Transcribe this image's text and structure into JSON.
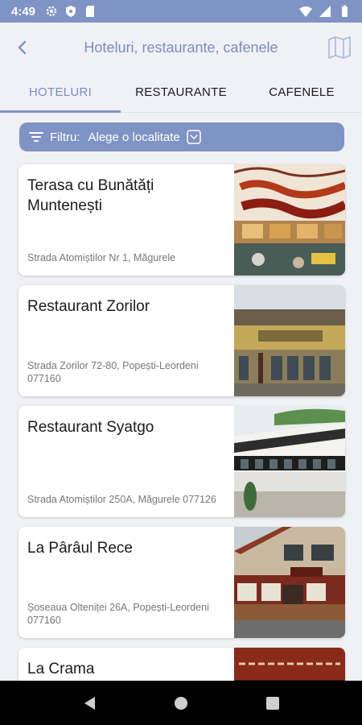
{
  "status_bar": {
    "time": "4:49"
  },
  "header": {
    "title": "Hoteluri, restaurante, cafenele"
  },
  "tabs": [
    {
      "label": "HOTELURI",
      "active": true
    },
    {
      "label": "RESTAURANTE",
      "active": false
    },
    {
      "label": "CAFENELE",
      "active": false
    }
  ],
  "filter": {
    "label": "Filtru:",
    "value": "Alege o localitate"
  },
  "items": [
    {
      "name": "Terasa cu Bunătăți Muntenești",
      "address": "Strada Atomiștilor Nr 1, Măgurele",
      "image": "terrace-sign-image"
    },
    {
      "name": "Restaurant Zorilor",
      "address": "Strada Zorilor 72-80, Popești-Leordeni 077160",
      "image": "building-facade-image"
    },
    {
      "name": "Restaurant Syatgo",
      "address": "Strada Atomiștilor 250A, Măgurele 077126",
      "image": "restaurant-building-image"
    },
    {
      "name": "La Pârâul Rece",
      "address": "Șoseaua Olteniței 26A, Popești-Leordeni 077160",
      "image": "restaurant-exterior-image"
    },
    {
      "name": "La Crama",
      "address": "",
      "image": "restaurant-sign-image"
    }
  ],
  "colors": {
    "accent": "#7f93c4",
    "accent_text": "#7a8ec4",
    "background": "#f0f1f5"
  }
}
